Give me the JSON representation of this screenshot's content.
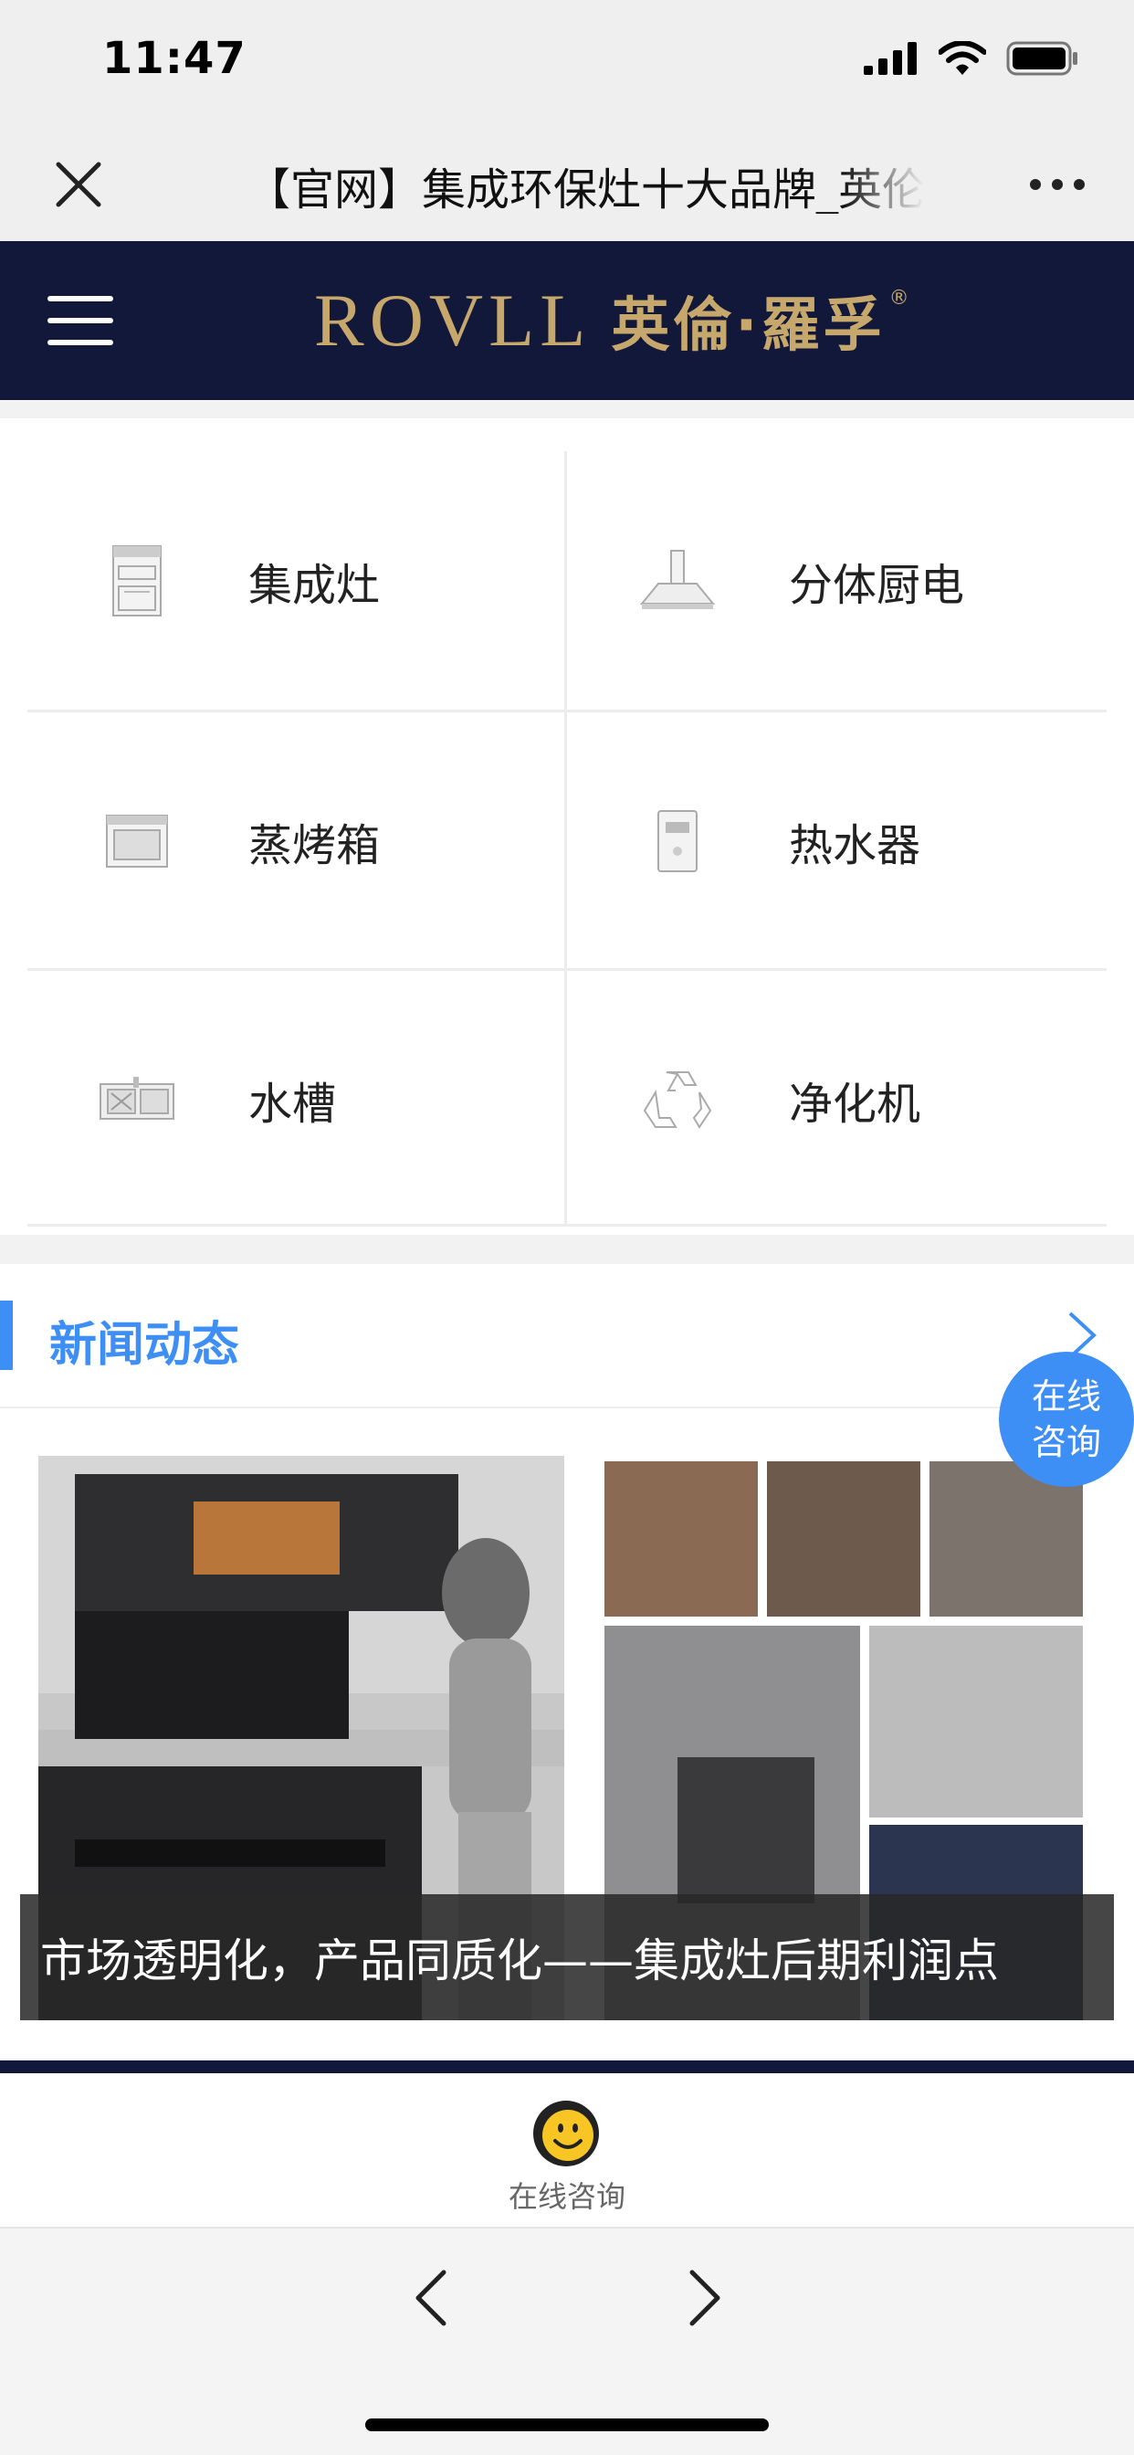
{
  "status": {
    "time": "11:47"
  },
  "nav": {
    "title": "【官网】集成环保灶十大品牌_英伦·罗孚"
  },
  "brand": {
    "logo_text": "ROVLL",
    "logo_cn": "英倫·羅孚",
    "reg": "®"
  },
  "categories": [
    {
      "label": "集成灶",
      "icon": "integrated-stove-icon"
    },
    {
      "label": "分体厨电",
      "icon": "range-hood-icon"
    },
    {
      "label": "蒸烤箱",
      "icon": "steam-oven-icon"
    },
    {
      "label": "热水器",
      "icon": "water-heater-icon"
    },
    {
      "label": "水槽",
      "icon": "sink-icon"
    },
    {
      "label": "净化机",
      "icon": "purifier-icon"
    }
  ],
  "news": {
    "title": "新闻动态",
    "caption": "市场透明化，产品同质化——集成灶后期利润点"
  },
  "float_consult": {
    "line1": "在线",
    "line2": "咨询"
  },
  "bottom": {
    "consult_label": "在线咨询"
  },
  "colors": {
    "accent": "#3d8ef5",
    "header_bg": "#12183a",
    "logo_gold": "#c6a76c"
  }
}
